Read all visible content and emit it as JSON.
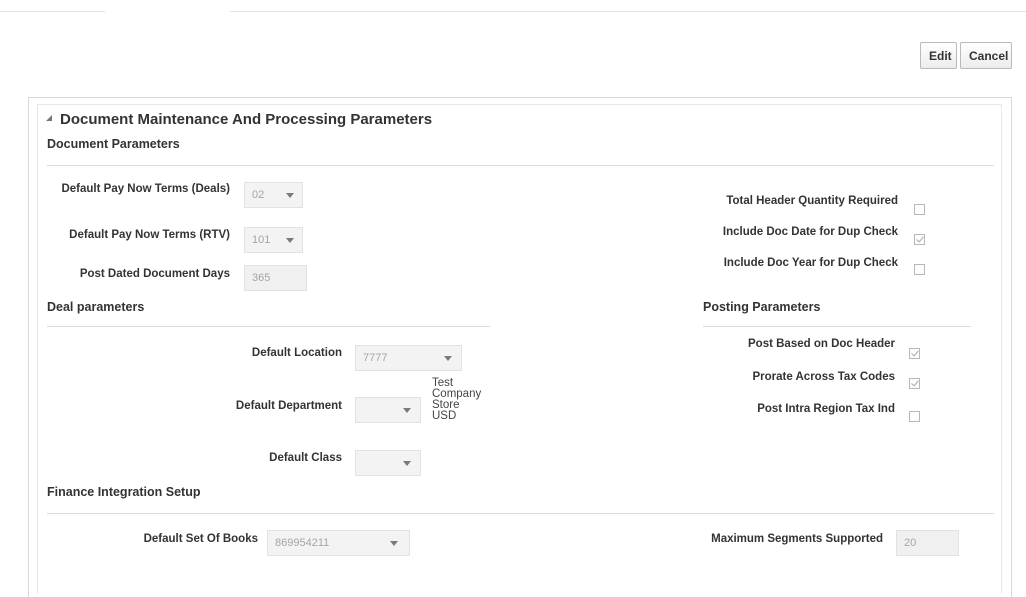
{
  "toolbar": {
    "edit_label": "Edit",
    "cancel_label": "Cancel"
  },
  "panel": {
    "title": "Document Maintenance And Processing Parameters"
  },
  "document_parameters": {
    "heading": "Document Parameters",
    "pay_now_deals": {
      "label": "Default Pay Now Terms (Deals)",
      "value": "02"
    },
    "pay_now_rtv": {
      "label": "Default Pay Now Terms (RTV)",
      "value": "101"
    },
    "post_dated_days": {
      "label": "Post Dated Document Days",
      "value": "365"
    },
    "total_header_qty": {
      "label": "Total Header Quantity Required",
      "checked": false
    },
    "doc_date_dup": {
      "label": "Include Doc Date for Dup Check",
      "checked": true
    },
    "doc_year_dup": {
      "label": "Include Doc Year for Dup Check",
      "checked": false
    }
  },
  "deal_parameters": {
    "heading": "Deal parameters",
    "default_location": {
      "label": "Default Location",
      "value": "7777"
    },
    "default_department": {
      "label": "Default Department",
      "value": "",
      "description": [
        "Test",
        "Company",
        "Store",
        "USD"
      ]
    },
    "default_class": {
      "label": "Default Class",
      "value": ""
    }
  },
  "posting_parameters": {
    "heading": "Posting Parameters",
    "post_doc_header": {
      "label": "Post Based on Doc Header",
      "checked": true
    },
    "prorate_tax": {
      "label": "Prorate Across Tax Codes",
      "checked": true
    },
    "post_intra_region": {
      "label": "Post Intra Region Tax Ind",
      "checked": false
    }
  },
  "finance_integration": {
    "heading": "Finance Integration Setup",
    "set_of_books": {
      "label": "Default Set Of Books",
      "value": "869954211"
    },
    "max_segments": {
      "label": "Maximum Segments Supported",
      "value": "20"
    }
  }
}
